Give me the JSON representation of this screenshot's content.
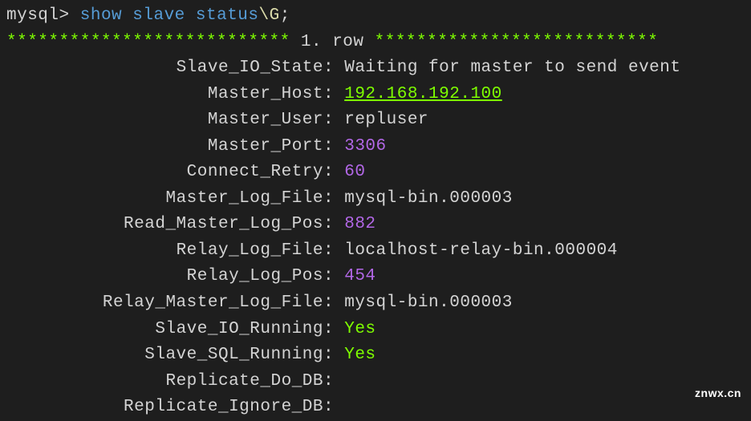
{
  "prompt": {
    "prefix": "mysql>",
    "command_show": "show",
    "command_slave": "slave",
    "command_status": "status",
    "slash": "\\G",
    "semicolon": ";"
  },
  "row_header": {
    "stars_left": "***************************",
    "number": "1.",
    "row_text": "row",
    "stars_right": "***************************"
  },
  "status": {
    "slave_io_state": {
      "label": "Slave_IO_State",
      "value": "Waiting for master to send event"
    },
    "master_host": {
      "label": "Master_Host",
      "value": "192.168.192.100"
    },
    "master_user": {
      "label": "Master_User",
      "value": "repluser"
    },
    "master_port": {
      "label": "Master_Port",
      "value": "3306"
    },
    "connect_retry": {
      "label": "Connect_Retry",
      "value": "60"
    },
    "master_log_file": {
      "label": "Master_Log_File",
      "value": "mysql-bin.000003"
    },
    "read_master_log_pos": {
      "label": "Read_Master_Log_Pos",
      "value": "882"
    },
    "relay_log_file": {
      "label": "Relay_Log_File",
      "value": "localhost-relay-bin.000004"
    },
    "relay_log_pos": {
      "label": "Relay_Log_Pos",
      "value": "454"
    },
    "relay_master_log_file": {
      "label": "Relay_Master_Log_File",
      "value": "mysql-bin.000003"
    },
    "slave_io_running": {
      "label": "Slave_IO_Running",
      "value": "Yes"
    },
    "slave_sql_running": {
      "label": "Slave_SQL_Running",
      "value": "Yes"
    },
    "replicate_do_db": {
      "label": "Replicate_Do_DB",
      "value": ""
    },
    "replicate_ignore_db": {
      "label": "Replicate_Ignore_DB",
      "value": ""
    }
  },
  "watermark": "znwx.cn"
}
